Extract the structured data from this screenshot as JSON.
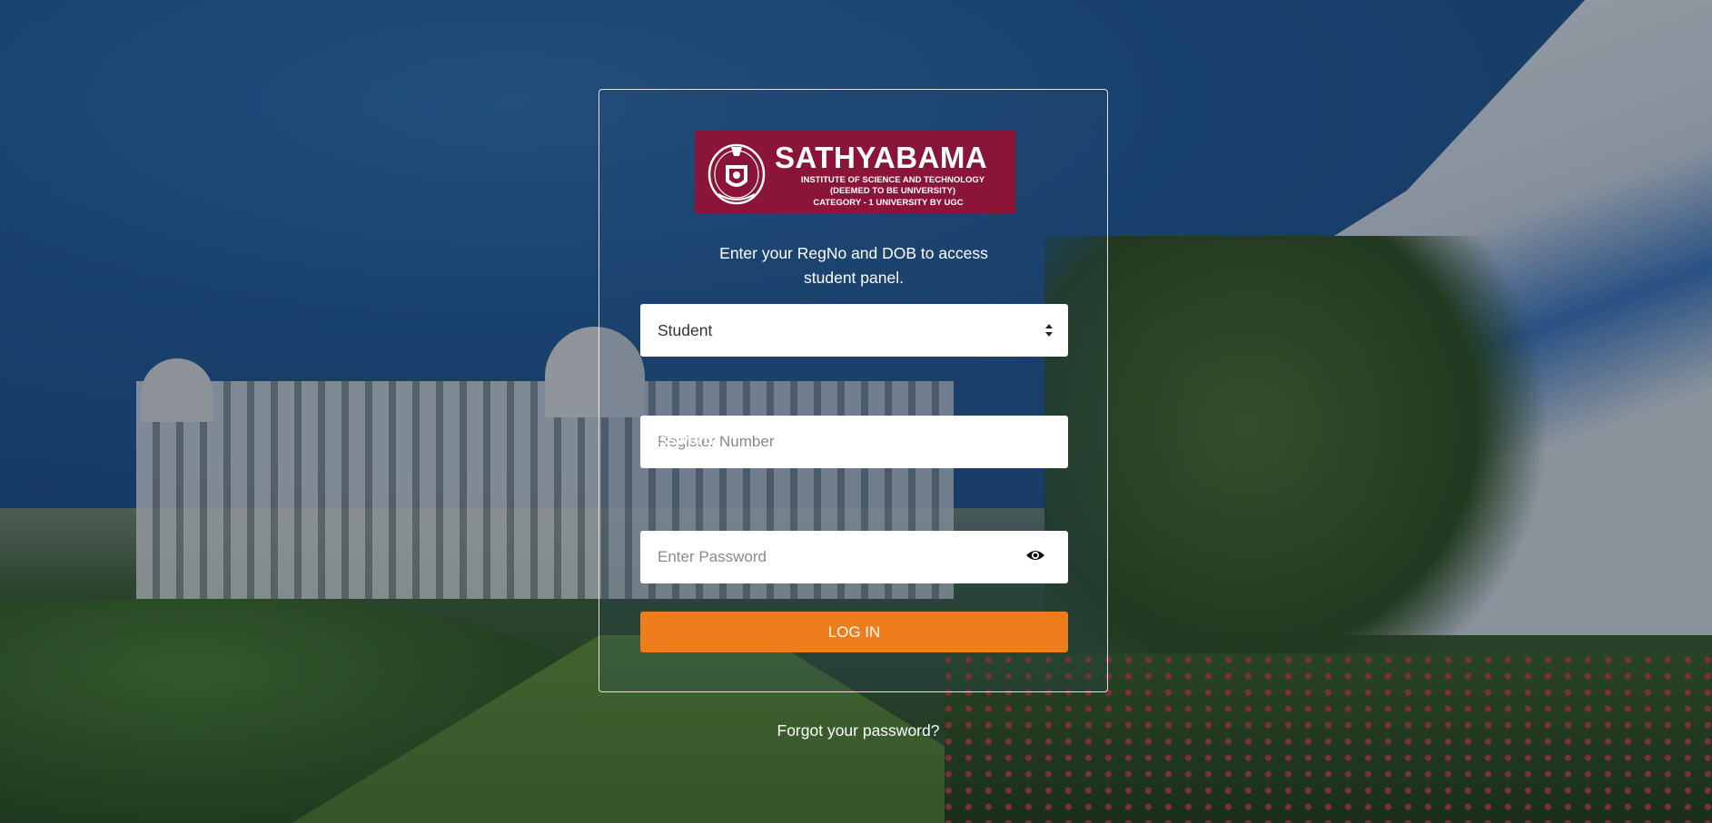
{
  "brand": {
    "logo_title": "SATHYABAMA",
    "logo_subtitle_line1": "INSTITUTE OF SCIENCE AND TECHNOLOGY",
    "logo_subtitle_line2": "(DEEMED TO BE UNIVERSITY)",
    "logo_category": "CATEGORY - 1 UNIVERSITY BY UGC",
    "logo_color": "#8b1538"
  },
  "login": {
    "intro_line1": "Enter your RegNo and DOB to access",
    "intro_line2": "student panel.",
    "role_select": {
      "selected": "Student",
      "icon": "select-arrows-icon"
    },
    "register_label": "Register Number",
    "register_placeholder": "Register Number",
    "register_value": "",
    "password_label": "Password",
    "password_placeholder": "Enter Password",
    "password_value": "",
    "password_toggle_icon": "eye-icon",
    "login_button": "LOG IN",
    "login_button_color": "#ee7d1c",
    "forgot_link": "Forgot your password?"
  }
}
